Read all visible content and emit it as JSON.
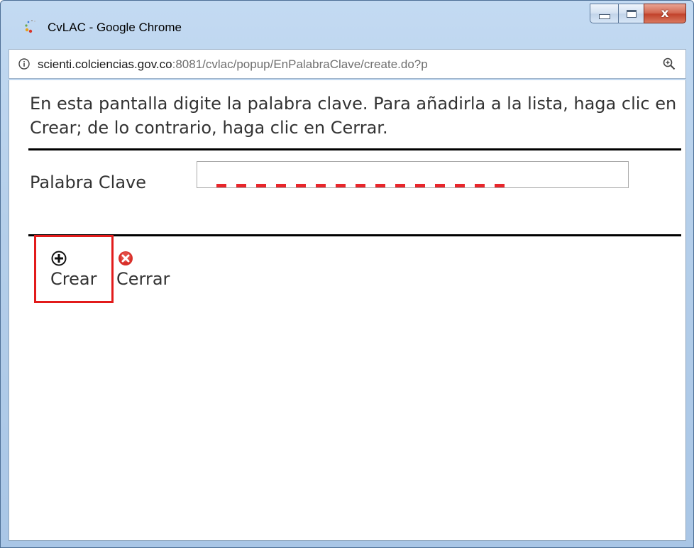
{
  "window": {
    "title": "CvLAC - Google Chrome",
    "controls": {
      "minimize": "minimize",
      "maximize": "maximize",
      "close": "x"
    }
  },
  "address_bar": {
    "host": "scienti.colciencias.gov.co",
    "path": ":8081/cvlac/popup/EnPalabraClave/create.do?p"
  },
  "form": {
    "instructions": "En esta pantalla digite la palabra clave. Para añadirla a la lista, haga clic en Crear; de lo contrario, haga clic en Cerrar.",
    "keyword_label": "Palabra Clave",
    "keyword_value": ""
  },
  "actions": {
    "create_label": "Crear",
    "close_label": "Cerrar"
  },
  "icons": {
    "app": "chrome-app-icon",
    "info": "info-icon",
    "zoom": "zoom-icon",
    "create": "plus-circle-icon",
    "close": "close-circle-icon"
  },
  "colors": {
    "highlight": "#e21b1b",
    "close_button": "#c2432c"
  }
}
